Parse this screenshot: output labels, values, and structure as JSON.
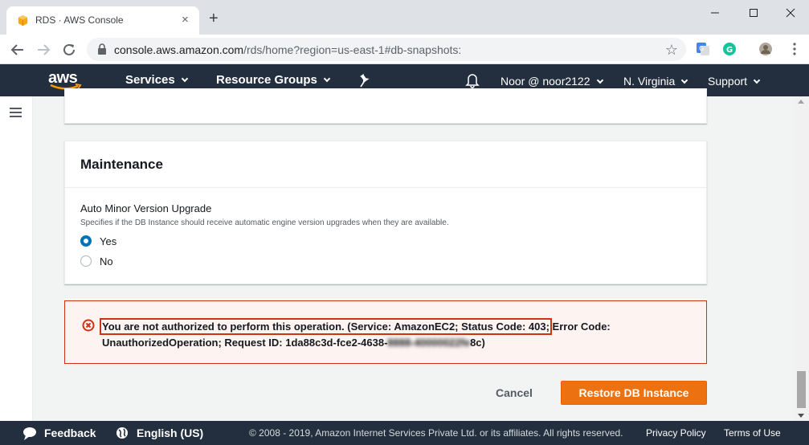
{
  "browser": {
    "tab_title": "RDS · AWS Console",
    "tab_close": "×",
    "new_tab": "+",
    "url_host": "console.aws.amazon.com",
    "url_rest": "/rds/home?region=us-east-1#db-snapshots:",
    "bookmark_star": "☆"
  },
  "aws_nav": {
    "logo": "aws",
    "services": "Services",
    "resource_groups": "Resource Groups",
    "account": "Noor @ noor2122",
    "region": "N. Virginia",
    "support": "Support"
  },
  "maintenance": {
    "title": "Maintenance",
    "field_label": "Auto Minor Version Upgrade",
    "field_desc": "Specifies if the DB Instance should receive automatic engine version upgrades when they are available.",
    "options": [
      {
        "label": "Yes",
        "selected": true
      },
      {
        "label": "No",
        "selected": false
      }
    ]
  },
  "error": {
    "highlighted": "You are not authorized to perform this operation. (Service: AmazonEC2; Status Code: 403;",
    "rest_a": " Error Code: UnauthorizedOperation; Request ID: 1da88c3d-fce2-4638-",
    "redacted": "8888-40000022fe",
    "rest_b": "8c)"
  },
  "actions": {
    "cancel": "Cancel",
    "restore": "Restore DB Instance"
  },
  "footer": {
    "feedback": "Feedback",
    "language": "English (US)",
    "copyright": "© 2008 - 2019, Amazon Internet Services Private Ltd. or its affiliates. All rights reserved.",
    "privacy": "Privacy Policy",
    "terms": "Terms of Use"
  },
  "colors": {
    "aws_nav": "#232f3e",
    "primary": "#ec7211",
    "error_border": "#d13212",
    "radio_selected": "#0073bb"
  }
}
